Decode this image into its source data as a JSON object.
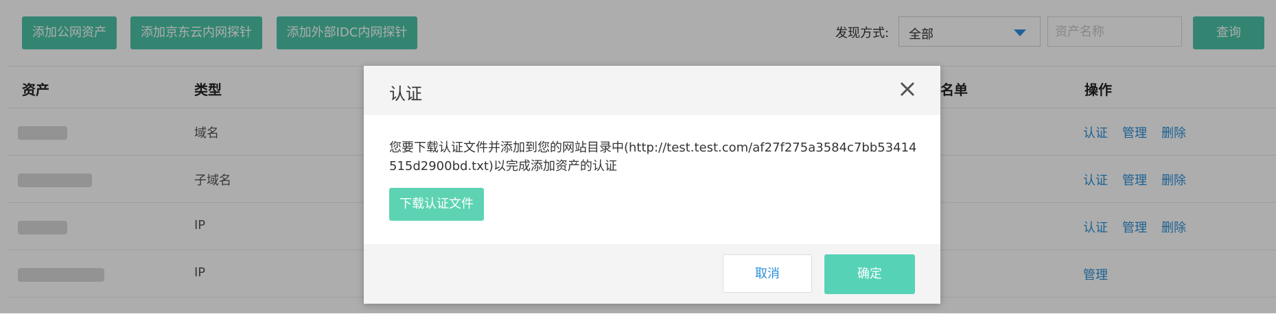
{
  "toolbar": {
    "buttons": [
      "添加公网资产",
      "添加京东云内网探针",
      "添加外部IDC内网探针"
    ],
    "filter_label": "发现方式:",
    "select_value": "全部",
    "search_placeholder": "资产名称",
    "query_label": "查询"
  },
  "table": {
    "headers": {
      "asset": "资产",
      "type": "类型",
      "whitelist": "白名单",
      "actions": "操作"
    },
    "rows": [
      {
        "type": "域名",
        "ops": [
          "认证",
          "管理",
          "删除"
        ]
      },
      {
        "type": "子域名",
        "ops": [
          "认证",
          "管理",
          "删除"
        ]
      },
      {
        "type": "IP",
        "ops": [
          "认证",
          "管理",
          "删除"
        ]
      },
      {
        "type": "IP",
        "ops": [
          "管理"
        ]
      }
    ]
  },
  "modal": {
    "title": "认证",
    "message": "您要下载认证文件并添加到您的网站目录中(http://test.test.com/af27f275a3584c7bb53414515d2900bd.txt)以完成添加资产的认证",
    "download_label": "下载认证文件",
    "cancel_label": "取消",
    "ok_label": "确定"
  },
  "colors": {
    "primary_green": "#4cc4a8",
    "link_blue": "#2b8fd8"
  }
}
